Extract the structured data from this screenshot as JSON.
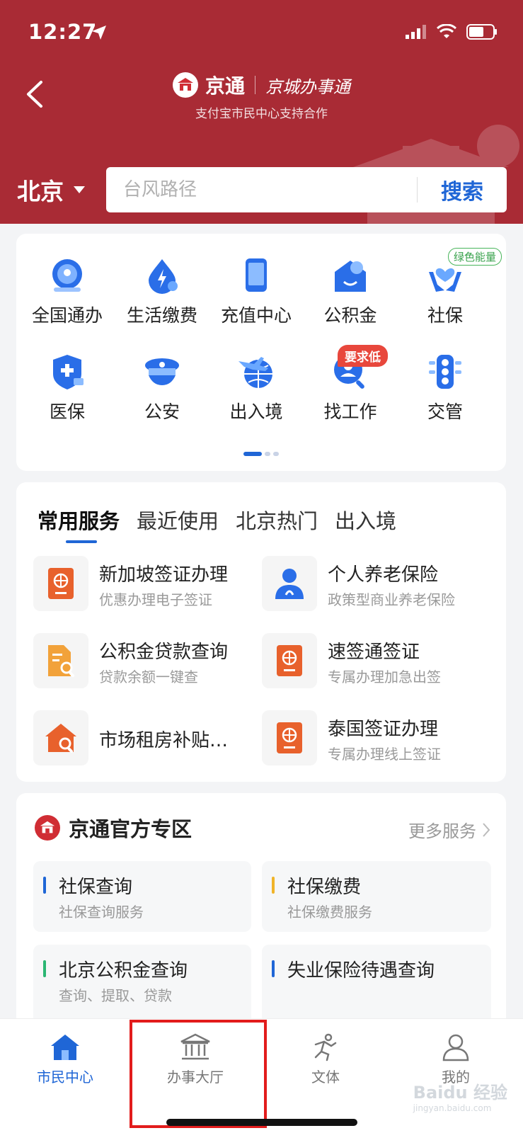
{
  "status_bar": {
    "time": "12:27"
  },
  "header": {
    "brand_name": "京通",
    "brand_sub_name": "京城办事通",
    "caption": "支付宝市民中心支持合作",
    "city": "北京",
    "search_placeholder": "台风路径",
    "search_button": "搜索"
  },
  "quick_grid": {
    "badge_green": "绿色能量",
    "badge_red": "要求低",
    "items": [
      {
        "label": "全国通办",
        "icon": "national-service-icon"
      },
      {
        "label": "生活缴费",
        "icon": "utility-payment-icon"
      },
      {
        "label": "充值中心",
        "icon": "phone-recharge-icon"
      },
      {
        "label": "公积金",
        "icon": "housing-fund-icon"
      },
      {
        "label": "社保",
        "icon": "social-security-icon"
      },
      {
        "label": "医保",
        "icon": "medical-insurance-icon"
      },
      {
        "label": "公安",
        "icon": "police-cap-icon"
      },
      {
        "label": "出入境",
        "icon": "plane-globe-icon"
      },
      {
        "label": "找工作",
        "icon": "job-search-icon"
      },
      {
        "label": "交管",
        "icon": "traffic-light-icon"
      }
    ]
  },
  "services": {
    "tabs": [
      "常用服务",
      "最近使用",
      "北京热门",
      "出入境"
    ],
    "items": [
      {
        "title": "新加坡签证办理",
        "subtitle": "优惠办理电子签证",
        "icon": "passport-icon"
      },
      {
        "title": "个人养老保险",
        "subtitle": "政策型商业养老保险",
        "icon": "person-icon"
      },
      {
        "title": "公积金贷款查询",
        "subtitle": "贷款余额一键查",
        "icon": "document-search-icon"
      },
      {
        "title": "速签通签证",
        "subtitle": "专属办理加急出签",
        "icon": "passport-icon"
      },
      {
        "title": "市场租房补贴…",
        "subtitle": "",
        "icon": "house-search-icon"
      },
      {
        "title": "泰国签证办理",
        "subtitle": "专属办理线上签证",
        "icon": "passport-icon"
      }
    ]
  },
  "official": {
    "title": "京通官方专区",
    "more": "更多服务",
    "tiles": [
      {
        "title": "社保查询",
        "subtitle": "社保查询服务",
        "color": "#1f66d6"
      },
      {
        "title": "社保缴费",
        "subtitle": "社保缴费服务",
        "color": "#f0b429"
      },
      {
        "title": "北京公积金查询",
        "subtitle": "查询、提取、贷款",
        "color": "#2bb673"
      },
      {
        "title": "失业保险待遇查询",
        "subtitle": "",
        "color": "#1f66d6"
      }
    ]
  },
  "tabbar": {
    "items": [
      {
        "label": "市民中心",
        "icon": "home-icon"
      },
      {
        "label": "办事大厅",
        "icon": "bank-hall-icon"
      },
      {
        "label": "文体",
        "icon": "runner-icon"
      },
      {
        "label": "我的",
        "icon": "profile-icon"
      }
    ]
  },
  "watermark": {
    "brand": "Baidu 经验",
    "url": "jingyan.baidu.com"
  },
  "colors": {
    "header": "#a92b35",
    "accent": "#1f66d6",
    "passport": "#e8612c",
    "highlight": "#e21c1c"
  }
}
